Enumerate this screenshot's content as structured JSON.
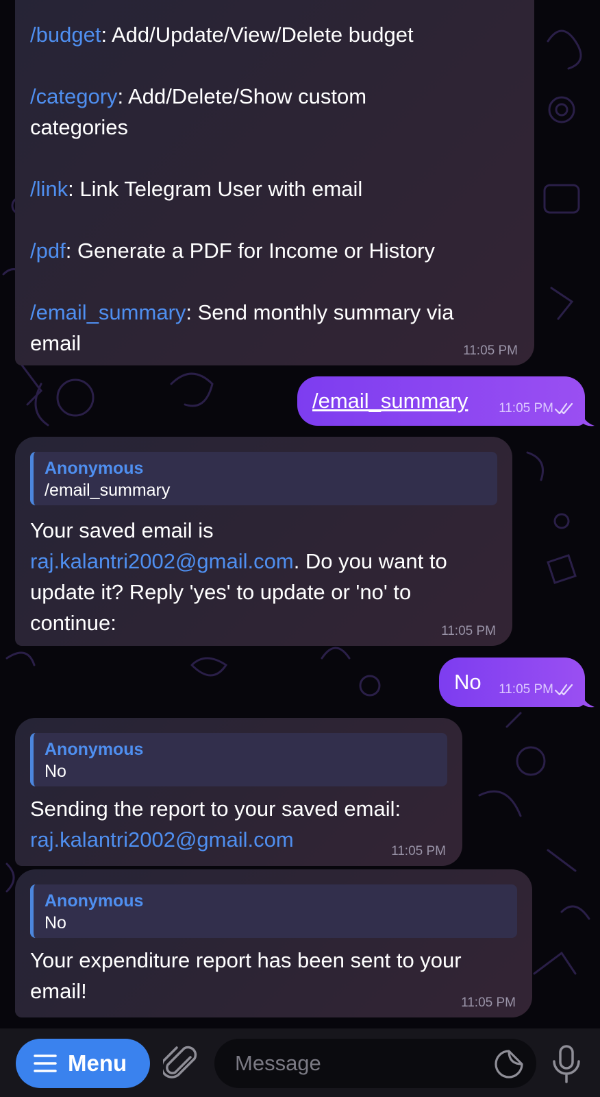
{
  "messages": {
    "help": {
      "lines": [
        {
          "cmd": "/budget",
          "text": ": Add/Update/View/Delete budget"
        },
        {
          "cmd": "/category",
          "text": ": Add/Delete/Show custom",
          "cont": "categories"
        },
        {
          "cmd": "/link",
          "text": ": Link Telegram User with email"
        },
        {
          "cmd": "/pdf",
          "text": ": Generate a PDF for Income or History"
        },
        {
          "cmd": "/email_summary",
          "text": ": Send monthly summary via",
          "cont": "email"
        }
      ],
      "time": "11:05 PM"
    },
    "out1": {
      "text": "/email_summary",
      "time": "11:05 PM"
    },
    "bot1": {
      "reply_name": "Anonymous",
      "reply_text": "/email_summary",
      "line1": "Your saved email is",
      "email": "raj.kalantri2002@gmail.com",
      "line2_rest": ". Do you want to",
      "line3": "update it? Reply 'yes' to update or 'no' to",
      "line4": "continue:",
      "time": "11:05 PM"
    },
    "out2": {
      "text": "No",
      "time": "11:05 PM"
    },
    "bot2": {
      "reply_name": "Anonymous",
      "reply_text": "No",
      "line1": "Sending the report to your saved email:",
      "email": "raj.kalantri2002@gmail.com",
      "time": "11:05 PM"
    },
    "bot3": {
      "reply_name": "Anonymous",
      "reply_text": "No",
      "line1": "Your expenditure report has been sent to your",
      "line2": "email!",
      "time": "11:05 PM"
    }
  },
  "bottom": {
    "menu_label": "Menu",
    "message_placeholder": "Message"
  },
  "icons": {
    "menu": "hamburger-icon",
    "attach": "paperclip-icon",
    "sticker": "sticker-icon",
    "mic": "microphone-icon",
    "read": "double-check-icon"
  },
  "colors": {
    "link": "#4f8ff0",
    "outgoing": "#8a45f1",
    "menu_button": "#3a82ee"
  }
}
